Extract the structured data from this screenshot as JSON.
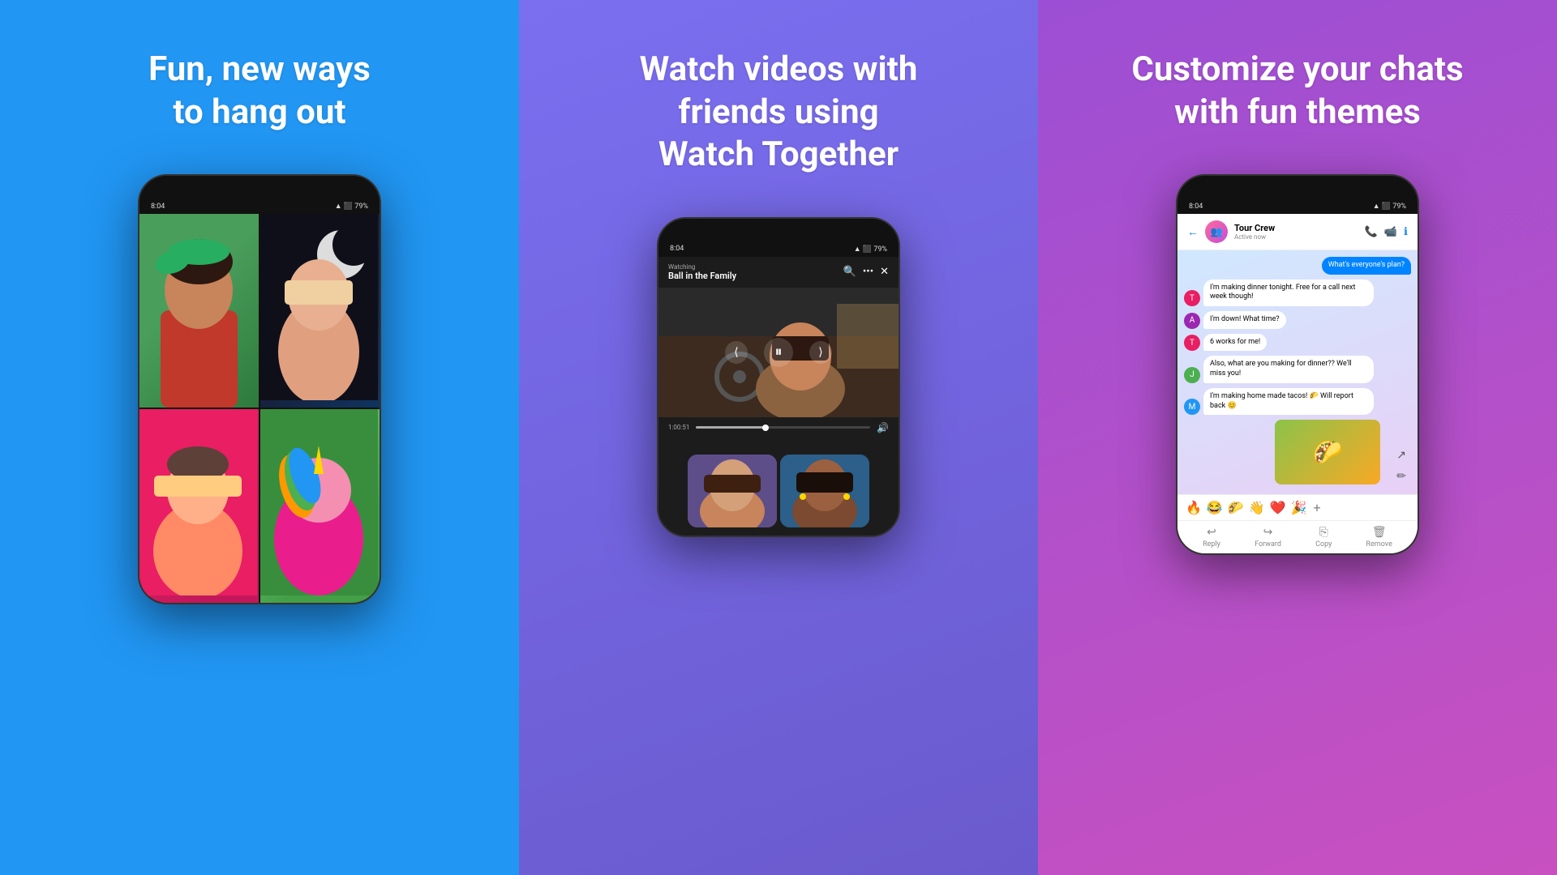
{
  "panels": [
    {
      "id": "panel-1",
      "title": "Fun, new ways\nto hang out",
      "bg_color": "#2196F3",
      "phone": {
        "status_left": "8:04",
        "status_right": "▲ ⬛ 79%"
      }
    },
    {
      "id": "panel-2",
      "title": "Watch videos with\nfriends using\nWatch Together",
      "bg_color": "#7B6FF0",
      "phone": {
        "status_left": "8:04",
        "status_right": "▲ ⬛ 79%",
        "watching_label": "Watching",
        "show_title": "Ball in the Family",
        "time_current": "1:00:51",
        "icons": [
          "🔍",
          "•••",
          "✕"
        ]
      }
    },
    {
      "id": "panel-3",
      "title": "Customize your chats\nwith fun themes",
      "bg_color": "#9C4FD4",
      "phone": {
        "status_left": "8:04",
        "status_right": "▲ ⬛ 79%",
        "chat_name": "Tour Crew",
        "chat_sub": "Active now",
        "messages": [
          {
            "type": "sent",
            "text": "What's everyone's plan?"
          },
          {
            "type": "recv",
            "text": "I'm making dinner tonight. Free for a call next week though!"
          },
          {
            "type": "recv",
            "text": "I'm down! What time?"
          },
          {
            "type": "recv",
            "text": "6 works for me!"
          },
          {
            "type": "recv",
            "text": "Also, what are you making for dinner?? We'll miss you!"
          },
          {
            "type": "recv",
            "text": "I'm making home made tacos! 🌮 Will report back 😊"
          }
        ],
        "reactions": [
          "🔥",
          "😂",
          "🌮",
          "👋",
          "❤️",
          "🎉"
        ],
        "footer_items": [
          "Reply",
          "Forward",
          "Copy",
          "Remove"
        ]
      }
    }
  ]
}
